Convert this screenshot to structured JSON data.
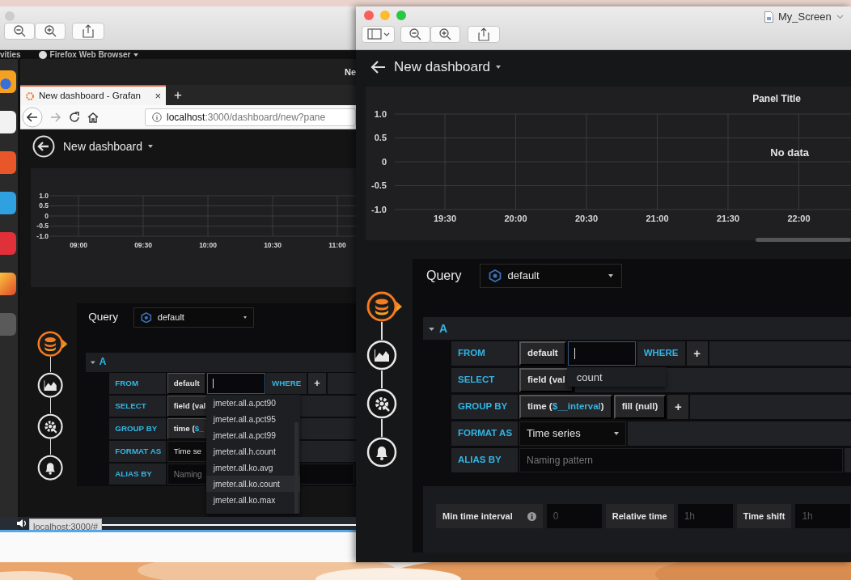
{
  "left_window": {
    "ubuntu_top_bar": {
      "activities": "vities",
      "app_menu": "Firefox Web Browser",
      "window_title": "Ne"
    },
    "browser": {
      "tab": {
        "title": "New dashboard - Grafan",
        "close": "×",
        "selected": true
      },
      "new_tab": "+",
      "url_host": "localhost",
      "url_path": ":3000/dashboard/new?pane"
    },
    "dashboard": {
      "title": "New dashboard",
      "chart_data": {
        "type": "line",
        "grid": true,
        "ylim": [
          -1,
          1
        ],
        "categories": [
          "09:00",
          "09:30",
          "10:00",
          "10:30",
          "11:00"
        ],
        "yticks": [
          {
            "value": 1,
            "label": "1.0"
          },
          {
            "value": 0.5,
            "label": "0.5"
          },
          {
            "value": 0,
            "label": "0"
          },
          {
            "value": -0.5,
            "label": "-0.5"
          },
          {
            "value": -1,
            "label": "-1.0"
          }
        ]
      },
      "editor_tabs": [
        {
          "kind": "queries",
          "selected": true
        },
        {
          "kind": "visualization",
          "selected": false
        },
        {
          "kind": "general",
          "selected": false
        },
        {
          "kind": "alert",
          "selected": false
        }
      ],
      "query": {
        "label": "Query",
        "datasource": "default",
        "ref": "A",
        "expanded": true,
        "rows": [
          {
            "label": "FROM",
            "parts": [
              {
                "kind": "segment",
                "text": "default"
              },
              {
                "kind": "input",
                "focused": true
              },
              {
                "kind": "keyword",
                "text": "WHERE"
              },
              {
                "kind": "add",
                "text": "+"
              }
            ]
          },
          {
            "label": "SELECT",
            "parts": [
              {
                "kind": "segment",
                "text": "field (val"
              }
            ]
          },
          {
            "label": "GROUP BY",
            "parts": [
              {
                "kind": "segment",
                "text": "time (",
                "variable": "$_"
              }
            ]
          },
          {
            "label": "FORMAT AS",
            "parts": [
              {
                "kind": "select",
                "text": "Time se",
                "caret": false
              }
            ]
          },
          {
            "label": "ALIAS BY",
            "parts": [
              {
                "kind": "input",
                "focused": false,
                "placeholder": "Naming"
              }
            ]
          }
        ],
        "suggestions": [
          {
            "text": "jmeter.all.a.pct90",
            "selected": false
          },
          {
            "text": "jmeter.all.a.pct95",
            "selected": false
          },
          {
            "text": "jmeter.all.a.pct99",
            "selected": false
          },
          {
            "text": "jmeter.all.h.count",
            "selected": false
          },
          {
            "text": "jmeter.all.ko.avg",
            "selected": false
          },
          {
            "text": "jmeter.all.ko.count",
            "selected": true
          },
          {
            "text": "jmeter.all.ko.max",
            "selected": false
          }
        ]
      }
    },
    "status_url": "localhost:3000/#"
  },
  "right_window": {
    "document_title": "My_Screen",
    "dashboard": {
      "title": "New dashboard",
      "panel_title": "Panel Title",
      "message": "No data",
      "chart_data": {
        "type": "line",
        "grid": true,
        "ylim": [
          -1,
          1
        ],
        "categories": [
          "19:30",
          "20:00",
          "20:30",
          "21:00",
          "21:30",
          "22:00"
        ],
        "yticks": [
          {
            "value": 1,
            "label": "1.0"
          },
          {
            "value": 0.5,
            "label": "0.5"
          },
          {
            "value": 0,
            "label": "0"
          },
          {
            "value": -0.5,
            "label": "-0.5"
          },
          {
            "value": -1,
            "label": "-1.0"
          }
        ]
      },
      "editor_tabs": [
        {
          "kind": "queries",
          "selected": true
        },
        {
          "kind": "visualization",
          "selected": false
        },
        {
          "kind": "general",
          "selected": false
        },
        {
          "kind": "alert",
          "selected": false
        }
      ],
      "query": {
        "label": "Query",
        "datasource": "default",
        "ref": "A",
        "expanded": true,
        "rows": [
          {
            "label": "FROM",
            "parts": [
              {
                "kind": "segment",
                "text": "default"
              },
              {
                "kind": "input",
                "focused": true
              },
              {
                "kind": "keyword",
                "text": "WHERE"
              },
              {
                "kind": "add",
                "text": "+"
              }
            ]
          },
          {
            "label": "SELECT",
            "parts": [
              {
                "kind": "segment",
                "text": "field (val"
              }
            ]
          },
          {
            "label": "GROUP BY",
            "parts": [
              {
                "kind": "segment",
                "text": "time (",
                "variable": "$__interval",
                "tail": ")"
              },
              {
                "kind": "segment",
                "text": "fill (null)"
              },
              {
                "kind": "add",
                "text": "+"
              }
            ]
          },
          {
            "label": "FORMAT AS",
            "parts": [
              {
                "kind": "select",
                "text": "Time series",
                "caret": true
              }
            ]
          },
          {
            "label": "ALIAS BY",
            "parts": [
              {
                "kind": "input",
                "focused": false,
                "placeholder": "Naming pattern"
              }
            ]
          }
        ],
        "suggestions": [
          {
            "text": "count",
            "selected": false
          }
        ],
        "options": [
          {
            "label": "Min time interval",
            "info": true,
            "placeholder": "0"
          },
          {
            "label": "Relative time",
            "info": false,
            "placeholder": "1h"
          },
          {
            "label": "Time shift",
            "info": false,
            "placeholder": "1h"
          }
        ]
      }
    }
  }
}
